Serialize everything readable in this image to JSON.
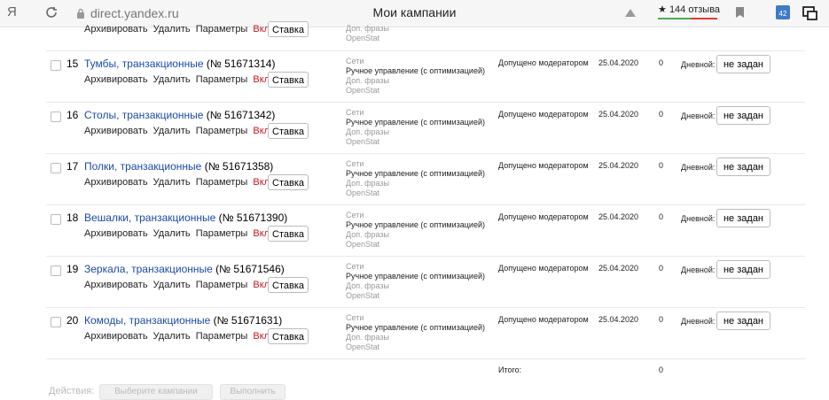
{
  "browser": {
    "logo": "Я",
    "url": "direct.yandex.ru",
    "title": "Мои кампании",
    "reviews": "144 отзыва",
    "reviews_star": "★",
    "extension_badge": "42",
    "icons": [
      "reload-icon",
      "lock-icon",
      "bookmark-icon",
      "star-icon"
    ]
  },
  "first_row": {
    "actions": {
      "archive": "Архивировать",
      "delete": "Удалить",
      "params": "Параметры",
      "enable": "Включить"
    },
    "stavka": "Ставка",
    "extra": "Доп. фразы",
    "openstat": "OpenStat"
  },
  "campaigns": [
    {
      "num": "15",
      "title": "Тумбы, транзакционные",
      "id": "(№ 51671314)"
    },
    {
      "num": "16",
      "title": "Столы, транзакционные",
      "id": "(№ 51671342)"
    },
    {
      "num": "17",
      "title": "Полки, транзакционные",
      "id": "(№ 51671358)"
    },
    {
      "num": "18",
      "title": "Вешалки, транзакционные",
      "id": "(№ 51671390)"
    },
    {
      "num": "19",
      "title": "Зеркала, транзакционные",
      "id": "(№ 51671546)"
    },
    {
      "num": "20",
      "title": "Комоды, транзакционные",
      "id": "(№ 51671631)"
    }
  ],
  "row_common": {
    "archive": "Архивировать",
    "delete": "Удалить",
    "params": "Параметры",
    "enable": "Включить",
    "stavka": "Ставка",
    "network": "Сети",
    "strategy": "Ручное управление (с оптимизацией)",
    "extra": "Доп. фразы",
    "openstat": "OpenStat",
    "status": "Допущено модератором",
    "date": "25.04.2020",
    "clicks": "0",
    "budget_label": "Дневной:",
    "budget_value": "не задан"
  },
  "total": {
    "label": "Итого:",
    "value": "0"
  },
  "bottom": {
    "label": "Действия:",
    "select": "Выберите кампании",
    "execute": "Выполнить"
  },
  "colors": {
    "link": "#1b4aa5",
    "enable": "#c4151c"
  }
}
